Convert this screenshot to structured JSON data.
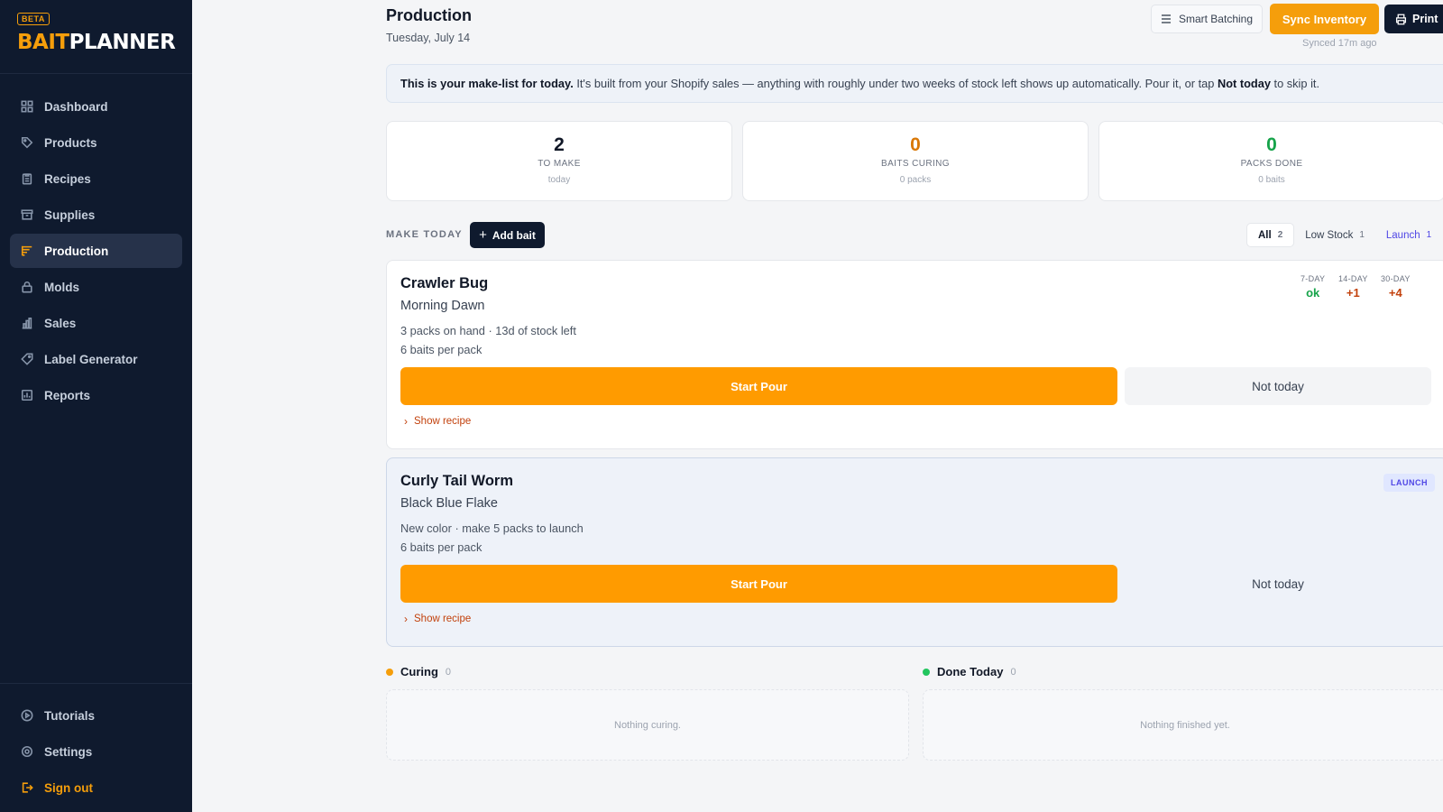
{
  "sidebar": {
    "beta": "BETA",
    "logo_a": "BAIT",
    "logo_b": "PLANNER",
    "items": [
      {
        "label": "Dashboard",
        "icon": "grid-icon"
      },
      {
        "label": "Products",
        "icon": "tag-icon"
      },
      {
        "label": "Recipes",
        "icon": "clipboard-icon"
      },
      {
        "label": "Supplies",
        "icon": "archive-icon"
      },
      {
        "label": "Production",
        "icon": "list-icon"
      },
      {
        "label": "Molds",
        "icon": "lock-icon"
      },
      {
        "label": "Sales",
        "icon": "bar-chart-icon"
      },
      {
        "label": "Label Generator",
        "icon": "label-icon"
      },
      {
        "label": "Reports",
        "icon": "report-icon"
      }
    ],
    "bottom": [
      {
        "label": "Tutorials",
        "icon": "play-circle-icon"
      },
      {
        "label": "Settings",
        "icon": "gear-icon"
      },
      {
        "label": "Sign out",
        "icon": "sign-out-icon"
      }
    ]
  },
  "header": {
    "title": "Production",
    "date": "Tuesday, July 14",
    "smart_batching": "Smart Batching",
    "sync": "Sync Inventory",
    "print": "Print",
    "synced": "Synced 17m ago"
  },
  "banner": {
    "lead": "This is your make-list for today.",
    "text": " It's built from your Shopify sales — anything with roughly under two weeks of stock left shows up automatically. Pour it, or tap ",
    "emph": "Not today",
    "tail": " to skip it."
  },
  "stats": [
    {
      "num": "2",
      "label": "TO MAKE",
      "sub": "today",
      "color": "#111827"
    },
    {
      "num": "0",
      "label": "BAITS CURING",
      "sub": "0 packs",
      "color": "#d97706"
    },
    {
      "num": "0",
      "label": "PACKS DONE",
      "sub": "0 baits",
      "color": "#16a34a"
    }
  ],
  "make_today": {
    "label": "MAKE TODAY",
    "add": "Add bait",
    "filters": [
      {
        "label": "All",
        "count": "2"
      },
      {
        "label": "Low Stock",
        "count": "1"
      },
      {
        "label": "Launch",
        "count": "1"
      }
    ]
  },
  "cards": [
    {
      "name": "Crawler Bug",
      "color": "Morning Dawn",
      "meta1": "3 packs on hand · 13d of stock left",
      "meta2": "6 baits per pack",
      "pour": "Start Pour",
      "skip": "Not today",
      "recipe": "Show recipe",
      "trends": [
        {
          "head": "7-DAY",
          "value": "ok",
          "color": "#16a34a"
        },
        {
          "head": "14-DAY",
          "value": "+1",
          "color": "#c2410c"
        },
        {
          "head": "30-DAY",
          "value": "+4",
          "color": "#c2410c"
        }
      ]
    },
    {
      "name": "Curly Tail Worm",
      "color": "Black Blue Flake",
      "meta1": "New color · make 5 packs to launch",
      "meta2": "6 baits per pack",
      "pour": "Start Pour",
      "skip": "Not today",
      "recipe": "Show recipe",
      "badge": "LAUNCH"
    }
  ],
  "curing": {
    "title": "Curing",
    "count": "0",
    "empty": "Nothing curing.",
    "color": "#f59e0b"
  },
  "done": {
    "title": "Done Today",
    "count": "0",
    "empty": "Nothing finished yet.",
    "color": "#22c55e"
  }
}
